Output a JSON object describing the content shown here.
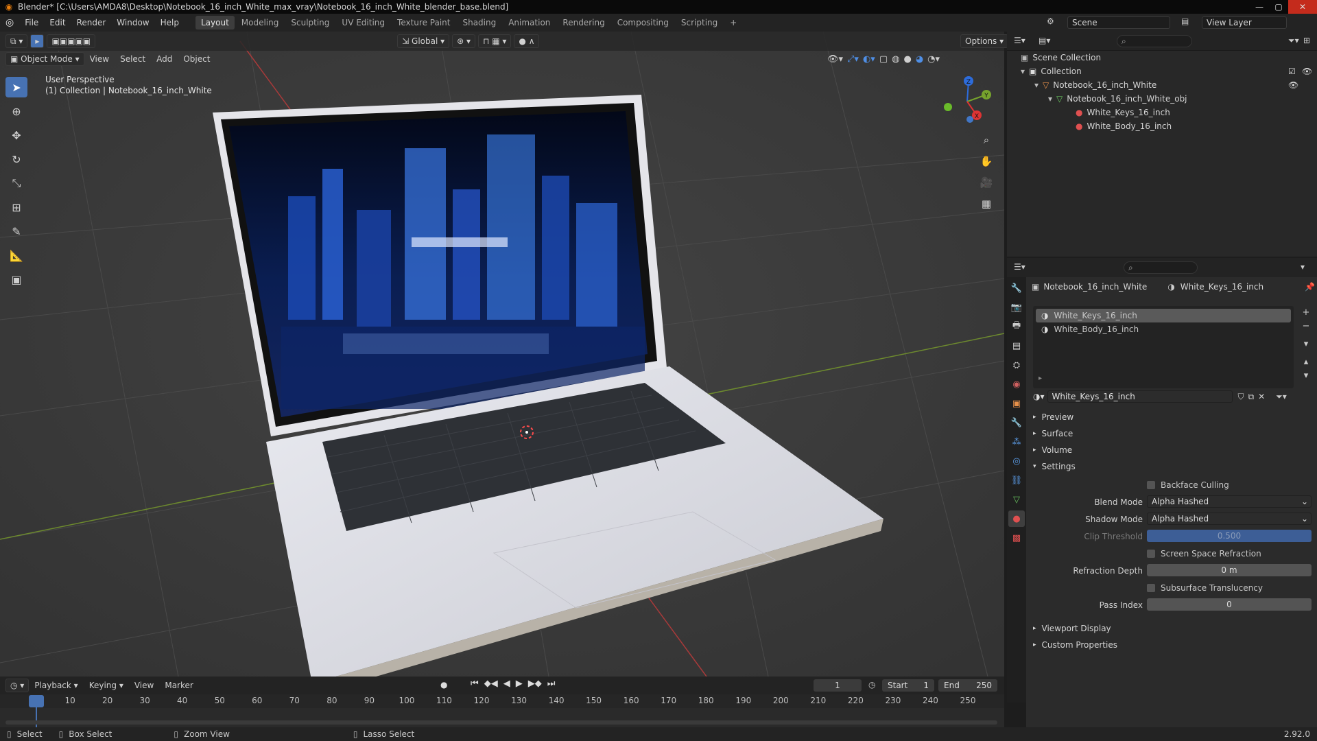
{
  "window": {
    "title": "Blender* [C:\\Users\\AMDA8\\Desktop\\Notebook_16_inch_White_max_vray\\Notebook_16_inch_White_blender_base.blend]",
    "version": "2.92.0"
  },
  "menu": [
    "File",
    "Edit",
    "Render",
    "Window",
    "Help"
  ],
  "workspaces": [
    "Layout",
    "Modeling",
    "Sculpting",
    "UV Editing",
    "Texture Paint",
    "Shading",
    "Animation",
    "Rendering",
    "Compositing",
    "Scripting"
  ],
  "active_workspace": "Layout",
  "scene": {
    "label": "Scene",
    "view_layer": "View Layer"
  },
  "viewport_header": {
    "orientation": "Global",
    "options": "Options",
    "mode": "Object Mode",
    "menus": [
      "View",
      "Select",
      "Add",
      "Object"
    ]
  },
  "viewport_info": {
    "line1": "User Perspective",
    "line2": "(1) Collection | Notebook_16_inch_White"
  },
  "gizmo": {
    "x": "X",
    "y": "Y",
    "z": "Z"
  },
  "outliner": {
    "rows": [
      {
        "label": "Scene Collection"
      },
      {
        "label": "Collection"
      },
      {
        "label": "Notebook_16_inch_White"
      },
      {
        "label": "Notebook_16_inch_White_obj"
      },
      {
        "label": "White_Keys_16_inch"
      },
      {
        "label": "White_Body_16_inch"
      }
    ]
  },
  "properties": {
    "breadcrumb_object": "Notebook_16_inch_White",
    "breadcrumb_material": "White_Keys_16_inch",
    "slots": [
      "White_Keys_16_inch",
      "White_Body_16_inch"
    ],
    "material_name": "White_Keys_16_inch",
    "sections": {
      "preview": "Preview",
      "surface": "Surface",
      "volume": "Volume",
      "settings": "Settings",
      "viewport_display": "Viewport Display",
      "custom_props": "Custom Properties"
    },
    "settings": {
      "backface_culling": "Backface Culling",
      "blend_mode_label": "Blend Mode",
      "blend_mode": "Alpha Hashed",
      "shadow_mode_label": "Shadow Mode",
      "shadow_mode": "Alpha Hashed",
      "clip_threshold_label": "Clip Threshold",
      "clip_threshold": "0.500",
      "ssr": "Screen Space Refraction",
      "refraction_depth_label": "Refraction Depth",
      "refraction_depth": "0 m",
      "subsurface": "Subsurface Translucency",
      "pass_index_label": "Pass Index",
      "pass_index": "0"
    }
  },
  "timeline": {
    "menus": [
      "Playback",
      "Keying",
      "View",
      "Marker"
    ],
    "current_frame": "1",
    "start_label": "Start",
    "start": "1",
    "end_label": "End",
    "end": "250",
    "ticks": [
      "1",
      "10",
      "20",
      "30",
      "40",
      "50",
      "60",
      "70",
      "80",
      "90",
      "100",
      "110",
      "120",
      "130",
      "140",
      "150",
      "160",
      "170",
      "180",
      "190",
      "200",
      "210",
      "220",
      "230",
      "240",
      "250"
    ]
  },
  "status": {
    "select": "Select",
    "box_select": "Box Select",
    "zoom_view": "Zoom View",
    "lasso_select": "Lasso Select"
  },
  "colors": {
    "accent": "#4772b3",
    "selected_row": "#5a5a5a",
    "orange": "#e87d0d"
  }
}
